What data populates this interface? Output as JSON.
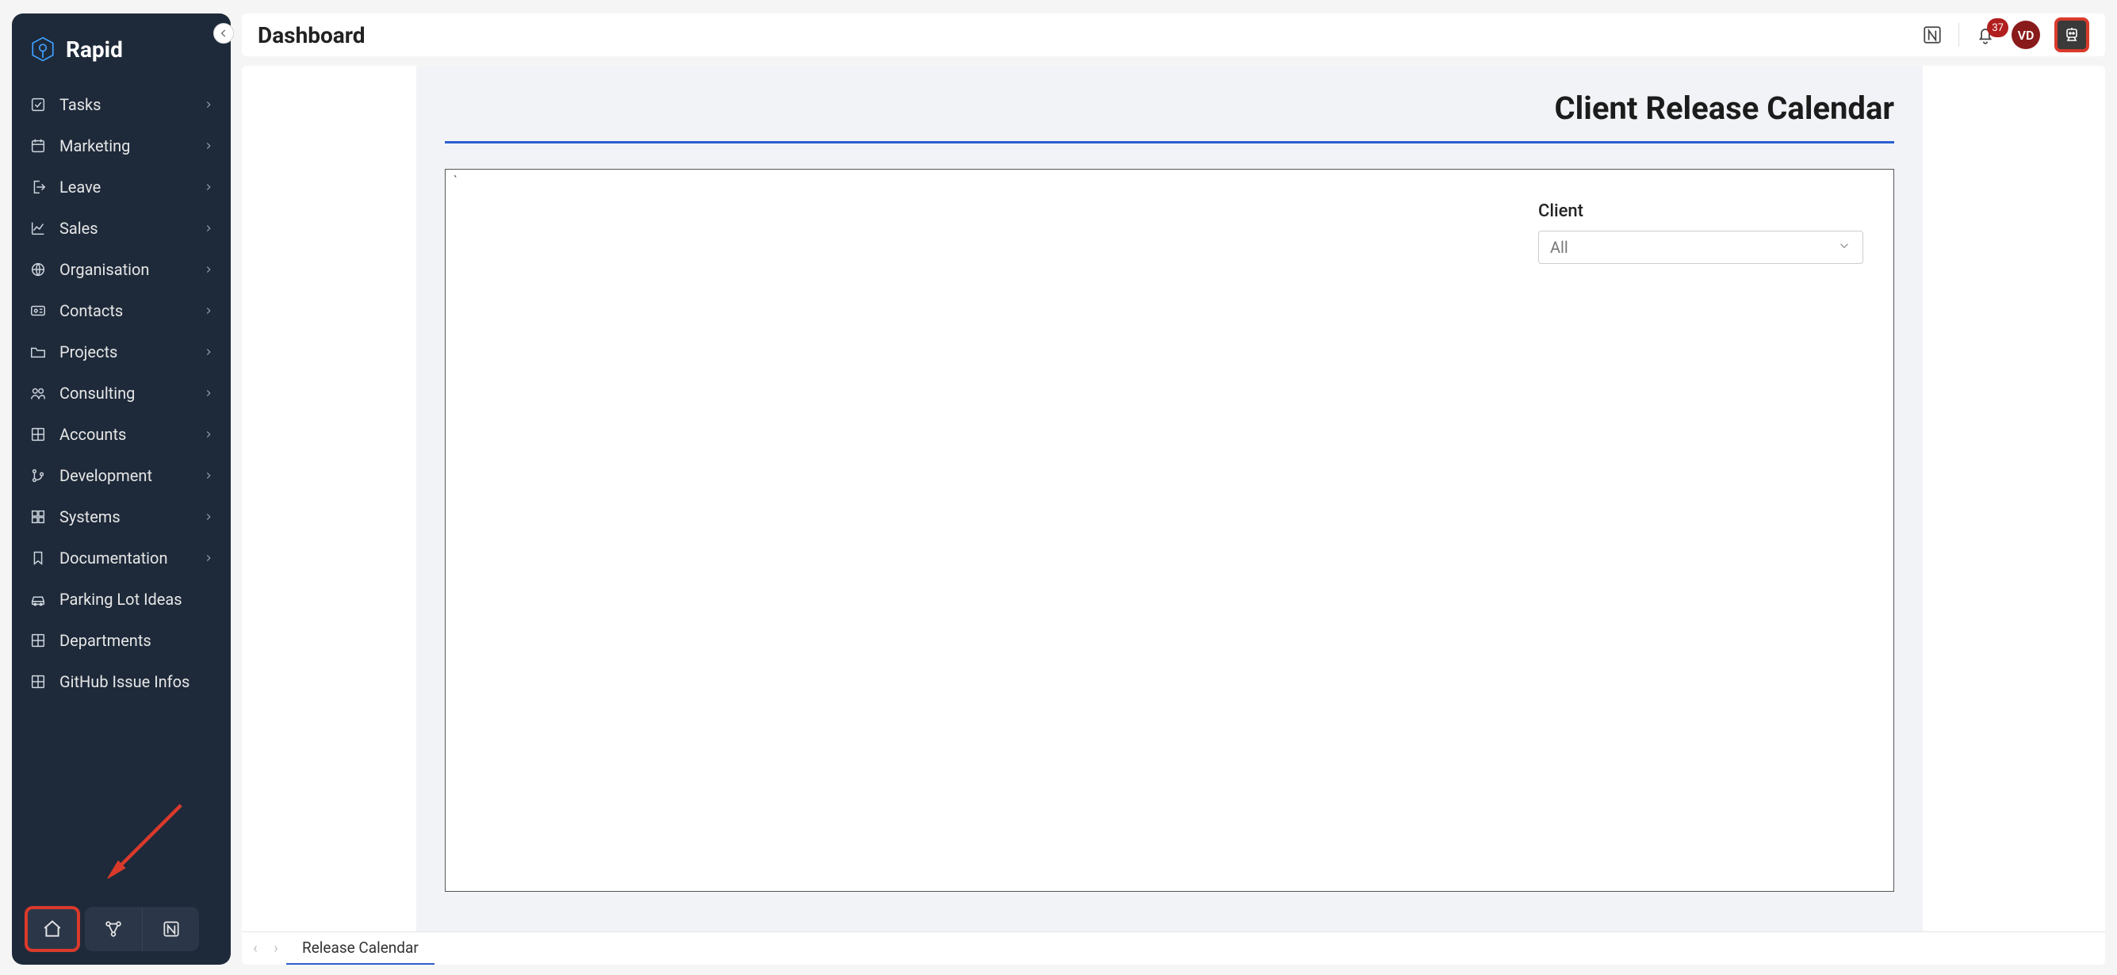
{
  "brand": {
    "name": "Rapid"
  },
  "header": {
    "title": "Dashboard",
    "notification_count": "37",
    "avatar_initials": "VD"
  },
  "sidebar": {
    "items": [
      {
        "label": "Tasks",
        "icon": "check-square-icon",
        "expandable": true
      },
      {
        "label": "Marketing",
        "icon": "calendar-icon",
        "expandable": true
      },
      {
        "label": "Leave",
        "icon": "logout-icon",
        "expandable": true
      },
      {
        "label": "Sales",
        "icon": "chart-line-icon",
        "expandable": true
      },
      {
        "label": "Organisation",
        "icon": "globe-icon",
        "expandable": true
      },
      {
        "label": "Contacts",
        "icon": "id-card-icon",
        "expandable": true
      },
      {
        "label": "Projects",
        "icon": "folder-icon",
        "expandable": true
      },
      {
        "label": "Consulting",
        "icon": "people-icon",
        "expandable": true
      },
      {
        "label": "Accounts",
        "icon": "grid-icon",
        "expandable": true
      },
      {
        "label": "Development",
        "icon": "branch-icon",
        "expandable": true
      },
      {
        "label": "Systems",
        "icon": "dashboard-icon",
        "expandable": true
      },
      {
        "label": "Documentation",
        "icon": "bookmark-icon",
        "expandable": true
      },
      {
        "label": "Parking Lot Ideas",
        "icon": "car-icon",
        "expandable": false
      },
      {
        "label": "Departments",
        "icon": "grid-icon",
        "expandable": false
      },
      {
        "label": "GitHub Issue Infos",
        "icon": "grid-icon",
        "expandable": false
      }
    ]
  },
  "panel": {
    "title": "Client Release Calendar",
    "client_label": "Client",
    "client_selected": "All"
  },
  "tabs": {
    "active": "Release Calendar"
  }
}
